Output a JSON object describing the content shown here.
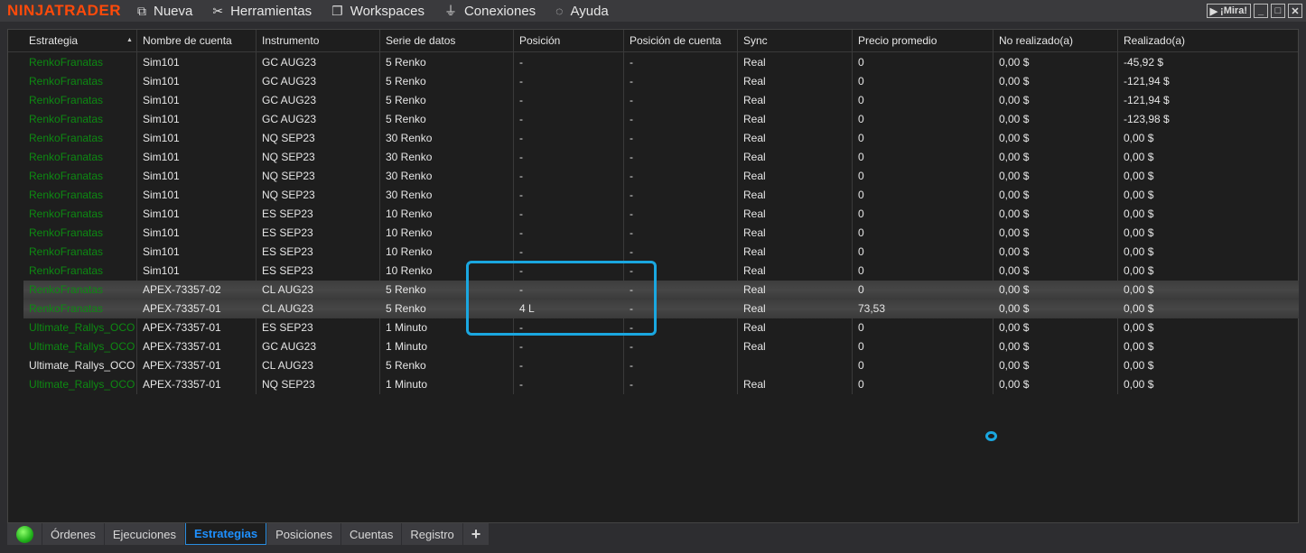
{
  "app": {
    "logo": "NINJATRADER",
    "mira": "¡Mira!"
  },
  "menu": [
    {
      "label": "Nueva",
      "icon": "new-window-icon"
    },
    {
      "label": "Herramientas",
      "icon": "tools-icon"
    },
    {
      "label": "Workspaces",
      "icon": "workspaces-icon"
    },
    {
      "label": "Conexiones",
      "icon": "plug-icon"
    },
    {
      "label": "Ayuda",
      "icon": "help-icon"
    }
  ],
  "columns": [
    "Estrategia",
    "Nombre de cuenta",
    "Instrumento",
    "Serie de datos",
    "Posición",
    "Posición de cuenta",
    "Sync",
    "Precio promedio",
    "No realizado(a)",
    "Realizado(a)"
  ],
  "rows": [
    [
      "RenkoFranatas",
      "Sim101",
      "GC AUG23",
      "5 Renko",
      "-",
      "-",
      "Real",
      "0",
      "0,00 $",
      "-45,92 $"
    ],
    [
      "RenkoFranatas",
      "Sim101",
      "GC AUG23",
      "5 Renko",
      "-",
      "-",
      "Real",
      "0",
      "0,00 $",
      "-121,94 $"
    ],
    [
      "RenkoFranatas",
      "Sim101",
      "GC AUG23",
      "5 Renko",
      "-",
      "-",
      "Real",
      "0",
      "0,00 $",
      "-121,94 $"
    ],
    [
      "RenkoFranatas",
      "Sim101",
      "GC AUG23",
      "5 Renko",
      "-",
      "-",
      "Real",
      "0",
      "0,00 $",
      "-123,98 $"
    ],
    [
      "RenkoFranatas",
      "Sim101",
      "NQ SEP23",
      "30 Renko",
      "-",
      "-",
      "Real",
      "0",
      "0,00 $",
      "0,00 $"
    ],
    [
      "RenkoFranatas",
      "Sim101",
      "NQ SEP23",
      "30 Renko",
      "-",
      "-",
      "Real",
      "0",
      "0,00 $",
      "0,00 $"
    ],
    [
      "RenkoFranatas",
      "Sim101",
      "NQ SEP23",
      "30 Renko",
      "-",
      "-",
      "Real",
      "0",
      "0,00 $",
      "0,00 $"
    ],
    [
      "RenkoFranatas",
      "Sim101",
      "NQ SEP23",
      "30 Renko",
      "-",
      "-",
      "Real",
      "0",
      "0,00 $",
      "0,00 $"
    ],
    [
      "RenkoFranatas",
      "Sim101",
      "ES SEP23",
      "10 Renko",
      "-",
      "-",
      "Real",
      "0",
      "0,00 $",
      "0,00 $"
    ],
    [
      "RenkoFranatas",
      "Sim101",
      "ES SEP23",
      "10 Renko",
      "-",
      "-",
      "Real",
      "0",
      "0,00 $",
      "0,00 $"
    ],
    [
      "RenkoFranatas",
      "Sim101",
      "ES SEP23",
      "10 Renko",
      "-",
      "-",
      "Real",
      "0",
      "0,00 $",
      "0,00 $"
    ],
    [
      "RenkoFranatas",
      "Sim101",
      "ES SEP23",
      "10 Renko",
      "-",
      "-",
      "Real",
      "0",
      "0,00 $",
      "0,00 $"
    ],
    [
      "RenkoFranatas",
      "APEX-73357-02",
      "CL AUG23",
      "5 Renko",
      "-",
      "-",
      "Real",
      "0",
      "0,00 $",
      "0,00 $"
    ],
    [
      "RenkoFranatas",
      "APEX-73357-01",
      "CL AUG23",
      "5 Renko",
      "4 L",
      "-",
      "Real",
      "73,53",
      "0,00 $",
      "0,00 $"
    ],
    [
      "Ultimate_Rallys_OCO",
      "APEX-73357-01",
      "ES SEP23",
      "1 Minuto",
      "-",
      "-",
      "Real",
      "0",
      "0,00 $",
      "0,00 $"
    ],
    [
      "Ultimate_Rallys_OCO",
      "APEX-73357-01",
      "GC AUG23",
      "1 Minuto",
      "-",
      "-",
      "Real",
      "0",
      "0,00 $",
      "0,00 $"
    ],
    [
      "Ultimate_Rallys_OCO",
      "APEX-73357-01",
      "CL AUG23",
      "5 Renko",
      "-",
      "-",
      "",
      "0",
      "0,00 $",
      "0,00 $"
    ],
    [
      "Ultimate_Rallys_OCO",
      "APEX-73357-01",
      "NQ SEP23",
      "1 Minuto",
      "-",
      "-",
      "Real",
      "0",
      "0,00 $",
      "0,00 $"
    ]
  ],
  "enabled": [
    true,
    true,
    true,
    true,
    true,
    true,
    true,
    true,
    true,
    true,
    true,
    true,
    true,
    true,
    true,
    true,
    false,
    true
  ],
  "selected_rows": [
    12,
    13
  ],
  "tabs": [
    "Órdenes",
    "Ejecuciones",
    "Estrategias",
    "Posiciones",
    "Cuentas",
    "Registro"
  ],
  "active_tab": "Estrategias",
  "add_tab": "+"
}
